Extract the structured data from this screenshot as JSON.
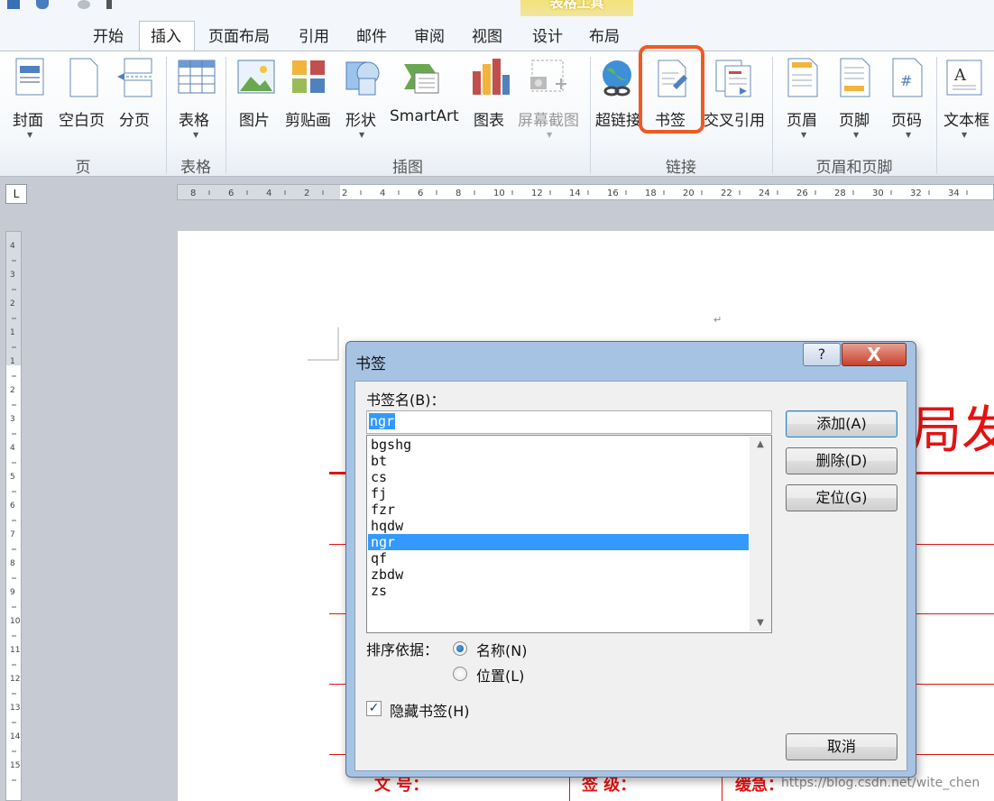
{
  "context_tab_group": "表格工具",
  "tabs": [
    "开始",
    "插入",
    "页面布局",
    "引用",
    "邮件",
    "审阅",
    "视图",
    "设计",
    "布局"
  ],
  "ribbon": {
    "buttons": {
      "cover": "封面",
      "blank_page": "空白页",
      "page_break": "分页",
      "table": "表格",
      "picture": "图片",
      "clipart": "剪贴画",
      "shapes": "形状",
      "smartart": "SmartArt",
      "chart": "图表",
      "screenshot": "屏幕截图",
      "hyperlink": "超链接",
      "bookmark": "书签",
      "cross_ref": "交叉引用",
      "header": "页眉",
      "footer": "页脚",
      "page_number": "页码",
      "textbox": "文本框"
    },
    "groups": {
      "pages": "页",
      "tables": "表格",
      "illustrations": "插图",
      "links": "链接",
      "header_footer": "页眉和页脚"
    },
    "highlight_color": "#f05a22"
  },
  "document": {
    "title_fragment": "局发",
    "row_labels": [
      "文 号：",
      "签 级：",
      "缓急："
    ],
    "accent_color": "#e41313"
  },
  "dialog": {
    "title": "书签",
    "help": "?",
    "close": "X",
    "name_label": "书签名(B)：",
    "name_value": "ngr",
    "bookmarks": [
      "bgshg",
      "bt",
      "cs",
      "fj",
      "fzr",
      "hqdw",
      "ngr",
      "qf",
      "zbdw",
      "zs"
    ],
    "selected_index": 6,
    "sort_label": "排序依据：",
    "sort_by_name": "名称(N)",
    "sort_by_location": "位置(L)",
    "sort_selected": "name",
    "hide_label": "隐藏书签(H)",
    "hide_checked": true,
    "btn_add": "添加(A)",
    "btn_delete": "删除(D)",
    "btn_goto": "定位(G)",
    "btn_cancel": "取消"
  },
  "ruler": {
    "top_ticks": [
      "8",
      "6",
      "4",
      "2",
      "2",
      "4",
      "6",
      "8",
      "10",
      "12",
      "14",
      "16",
      "18",
      "20",
      "22",
      "24",
      "26",
      "28",
      "30",
      "32",
      "34"
    ],
    "side_ticks": [
      "4",
      "3",
      "2",
      "1",
      "1",
      "2",
      "3",
      "4",
      "5",
      "6",
      "7",
      "8",
      "9",
      "10",
      "11",
      "12",
      "13",
      "14",
      "15"
    ]
  },
  "watermark": "https://blog.csdn.net/wite_chen"
}
